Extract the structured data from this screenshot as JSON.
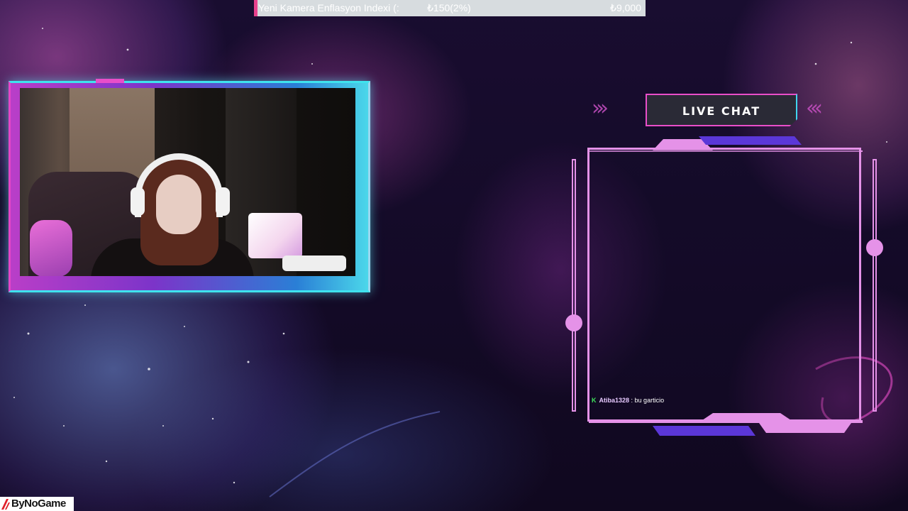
{
  "ticker": {
    "name": "Yeni Kamera Enflasyon Indexi (:",
    "price": "₺150(2%)",
    "total": "₺9,000"
  },
  "chat": {
    "title": "LIVE CHAT",
    "messages": [
      {
        "user": "Atiba1328",
        "separator": " : ",
        "text": "bu garticio"
      }
    ]
  },
  "watermark": {
    "text": "ByNoGame"
  },
  "colors": {
    "accent_pink": "#e94ec9",
    "accent_cyan": "#40d6ee",
    "chat_border": "#e592e8",
    "chat_badge": "#3ee35a",
    "ticker_bg": "#d7dcdf"
  },
  "icons": [
    "chevrons-right-icon",
    "chevrons-left-icon",
    "moderator-badge-icon",
    "bynogame-logo-icon"
  ]
}
